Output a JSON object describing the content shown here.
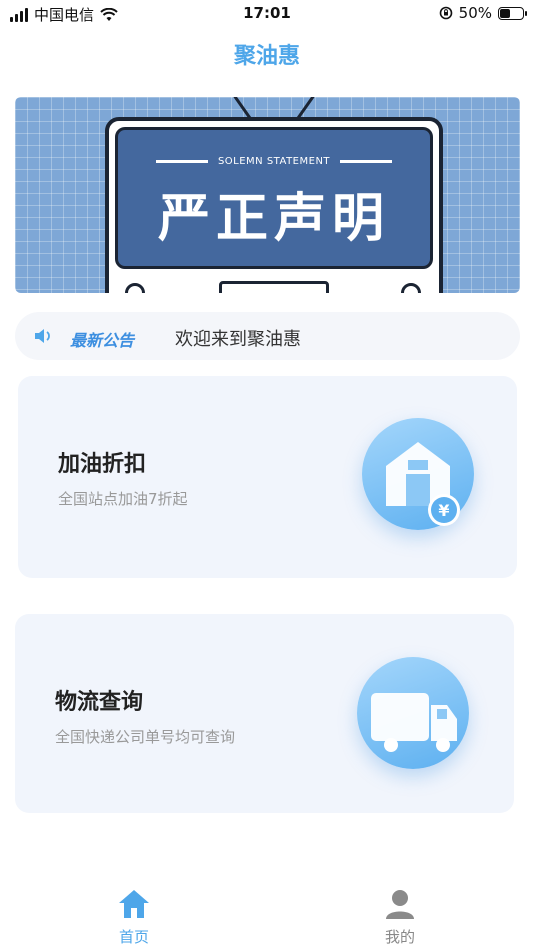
{
  "status_bar": {
    "carrier": "中国电信",
    "time": "17:01",
    "battery_text": "50%",
    "battery_level": 0.5
  },
  "nav": {
    "title": "聚油惠"
  },
  "banner": {
    "subtitle": "SOLEMN STATEMENT",
    "title": "严正声明"
  },
  "notice": {
    "icon": "speaker-icon",
    "tag": "最新公告",
    "text": "欢迎来到聚油惠"
  },
  "cards": [
    {
      "title": "加油折扣",
      "subtitle": "全国站点加油7折起",
      "icon": "gas-station-icon",
      "icon_badge": "¥"
    },
    {
      "title": "物流查询",
      "subtitle": "全国快递公司单号均可查询",
      "icon": "truck-icon"
    }
  ],
  "tabbar": {
    "items": [
      {
        "label": "首页",
        "icon": "home-icon",
        "active": true,
        "color": "#4ea6e9"
      },
      {
        "label": "我的",
        "icon": "user-icon",
        "active": false,
        "color": "#888888"
      }
    ]
  },
  "colors": {
    "accent": "#4ea6e9",
    "card_bg": "#f1f5fc",
    "notice_bg": "#f4f6fa"
  }
}
